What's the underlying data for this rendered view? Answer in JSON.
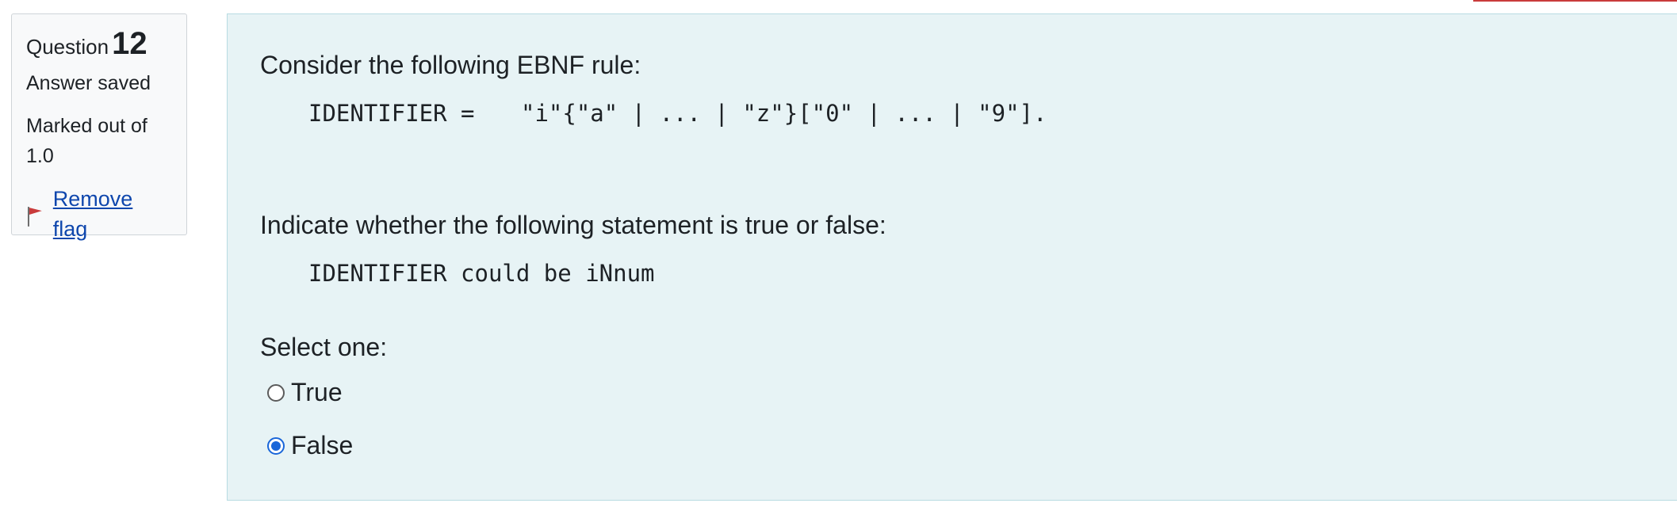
{
  "colors": {
    "panel_background": "#e7f3f5",
    "info_background": "#f8f9fa",
    "link": "#0f47ad",
    "radio_selected": "#1a66d9",
    "flag": "#c93b3b"
  },
  "info": {
    "question_word": "Question",
    "question_number": "12",
    "state": "Answer saved",
    "grade_line1": "Marked out of",
    "grade_line2": "1.0",
    "flag_icon": "flag-icon",
    "flag_label": "Remove flag"
  },
  "question": {
    "intro": "Consider the following EBNF rule:",
    "rule_lhs": "IDENTIFIER =",
    "rule_rhs": "\"i\"{\"a\" | ... | \"z\"}[\"0\" | ... | \"9\"].",
    "prompt": "Indicate whether the following statement is true or false:",
    "statement": "IDENTIFIER could be iNnum",
    "select_label": "Select one:",
    "options": [
      {
        "label": "True",
        "selected": false
      },
      {
        "label": "False",
        "selected": true
      }
    ]
  }
}
